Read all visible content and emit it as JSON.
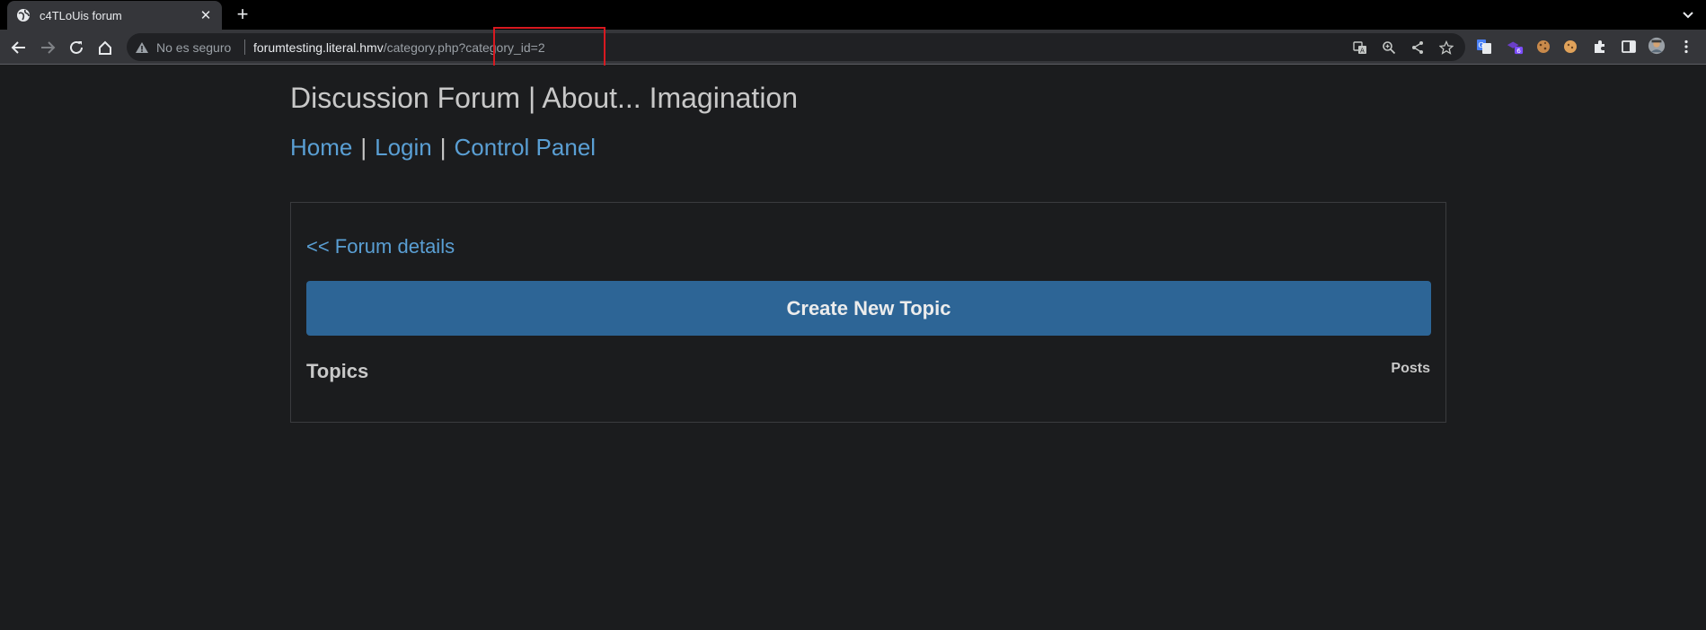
{
  "browser": {
    "tab": {
      "title": "c4TLoUis forum",
      "close": "✕"
    },
    "new_tab": "+",
    "omnibox": {
      "security_label": "No es seguro",
      "url_host": "forumtesting.literal.hmv",
      "url_path": "/category.php?category_id=2"
    },
    "extension_badge": "6"
  },
  "page": {
    "site_title": "Discussion Forum | About... Imagination",
    "nav": {
      "home": "Home",
      "login": "Login",
      "control_panel": "Control Panel",
      "separator": "|"
    },
    "back_link": "<< Forum details",
    "create_button": "Create New Topic",
    "table": {
      "topics_header": "Topics",
      "posts_header": "Posts"
    }
  },
  "colors": {
    "page_bg": "#1b1c1e",
    "link": "#5a9fd4",
    "button_bg": "#2d6596",
    "highlight": "#d71920"
  }
}
